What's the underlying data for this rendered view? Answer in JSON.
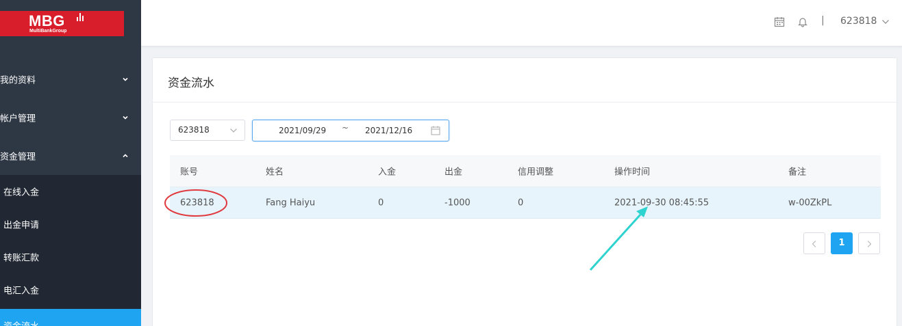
{
  "brand": {
    "logo_text": "MBG",
    "logo_subtext": "MultiBankGroup",
    "color": "#d81e2a"
  },
  "sidebar": {
    "items": [
      {
        "label": "我的资料",
        "icon": "chevron-down-icon"
      },
      {
        "label": "帐户管理",
        "icon": "chevron-down-icon"
      },
      {
        "label": "资金管理",
        "icon": "chevron-up-icon"
      }
    ],
    "subitems": [
      {
        "label": "在线入金"
      },
      {
        "label": "出金申请"
      },
      {
        "label": "转账汇款"
      },
      {
        "label": "电汇入金"
      },
      {
        "label": "资金流水",
        "active": true
      }
    ],
    "active_color": "#1fa4f2"
  },
  "header": {
    "icons": [
      "calendar-icon",
      "bell-icon"
    ],
    "separator": "|",
    "user": "623818"
  },
  "page": {
    "title": "资金流水"
  },
  "filters": {
    "account_select": "623818",
    "date_start": "2021/09/29",
    "date_separator": "~",
    "date_end": "2021/12/16"
  },
  "table": {
    "columns": [
      "账号",
      "姓名",
      "入金",
      "出金",
      "信用调整",
      "操作时间",
      "备注"
    ],
    "rows": [
      [
        "623818",
        "Fang Haiyu",
        "0",
        "-1000",
        "0",
        "2021-09-30 08:45:55",
        "w-00ZkPL"
      ]
    ]
  },
  "pagination": {
    "current": "1"
  },
  "annotations": {
    "circle_color": "#e0393e",
    "arrow_color": "#2ed3d0"
  }
}
